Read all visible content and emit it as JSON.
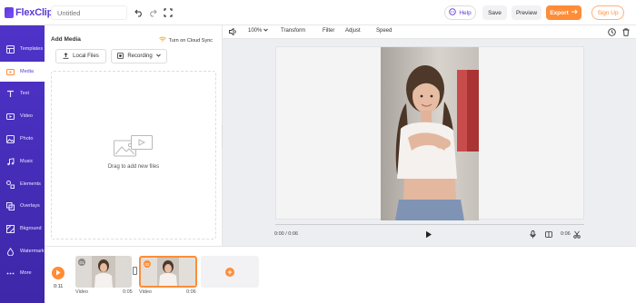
{
  "app": {
    "logo_text": "FlexClip",
    "project_title_placeholder": "Untitled"
  },
  "topbar": {
    "help_label": "Help",
    "save_label": "Save",
    "preview_label": "Preview",
    "export_label": "Export",
    "signup_label": "Sign Up"
  },
  "sidebar": {
    "items": [
      {
        "label": "Templates",
        "icon": "templates-icon"
      },
      {
        "label": "Media",
        "icon": "media-icon"
      },
      {
        "label": "Text",
        "icon": "text-icon"
      },
      {
        "label": "Video",
        "icon": "video-icon"
      },
      {
        "label": "Photo",
        "icon": "photo-icon"
      },
      {
        "label": "Music",
        "icon": "music-icon"
      },
      {
        "label": "Elements",
        "icon": "elements-icon"
      },
      {
        "label": "Overlays",
        "icon": "overlays-icon"
      },
      {
        "label": "Bkground",
        "icon": "background-icon"
      },
      {
        "label": "Watermark",
        "icon": "watermark-icon"
      },
      {
        "label": "More",
        "icon": "more-icon"
      }
    ]
  },
  "media_panel": {
    "title": "Add Media",
    "cloud_sync_label": "Turn on Cloud Sync",
    "local_files_label": "Local Files",
    "recording_label": "Recording",
    "drop_text": "Drag to add new files"
  },
  "editor_toolbar": {
    "zoom": "100%",
    "transform_label": "Transform",
    "filter_label": "Filter",
    "adjust_label": "Adjust",
    "speed_label": "Speed"
  },
  "player": {
    "current_time": "0:00 / 0:06",
    "clip_duration": "0:06"
  },
  "timeline": {
    "total_time": "0:11",
    "clips": [
      {
        "badge": "01",
        "type": "Video",
        "duration": "0:05"
      },
      {
        "badge": "02",
        "type": "Video",
        "duration": "0:06"
      }
    ]
  },
  "colors": {
    "brand_purple": "#5b3ad6",
    "accent_orange": "#ff8c37"
  }
}
